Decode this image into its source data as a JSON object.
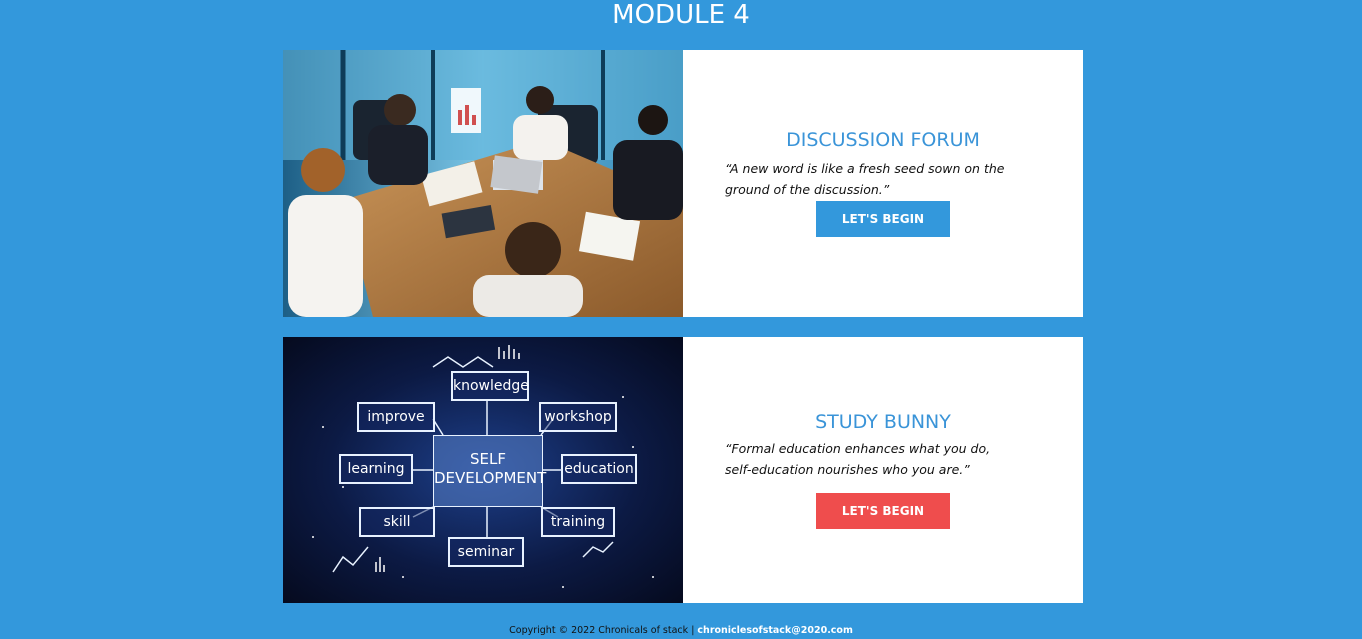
{
  "page": {
    "title": "MODULE 4"
  },
  "cards": [
    {
      "title": "DISCUSSION FORUM",
      "quote": "“A new word is like a fresh seed sown on the ground of the discussion.”",
      "button_label": "LET'S BEGIN",
      "button_color": "#3398dc",
      "image": "meeting-photo"
    },
    {
      "title": "STUDY BUNNY",
      "quote": "“Formal education enhances what you do, self-education nourishes who you are.”",
      "button_label": "LET'S BEGIN",
      "button_color": "#ef4d4d",
      "image": "self-development-diagram",
      "diagram": {
        "center": "SELF DEVELOPMENT",
        "nodes": [
          "knowledge",
          "improve",
          "workshop",
          "learning",
          "education",
          "skill",
          "training",
          "seminar"
        ]
      }
    }
  ],
  "footer": {
    "copyright": "Copyright © 2022 Chronicals of stack",
    "separator": "|",
    "email": "chroniclesofstack@2020.com"
  },
  "colors": {
    "background": "#3398dc",
    "accent_blue": "#3a94d8",
    "accent_red": "#ef4d4d"
  }
}
